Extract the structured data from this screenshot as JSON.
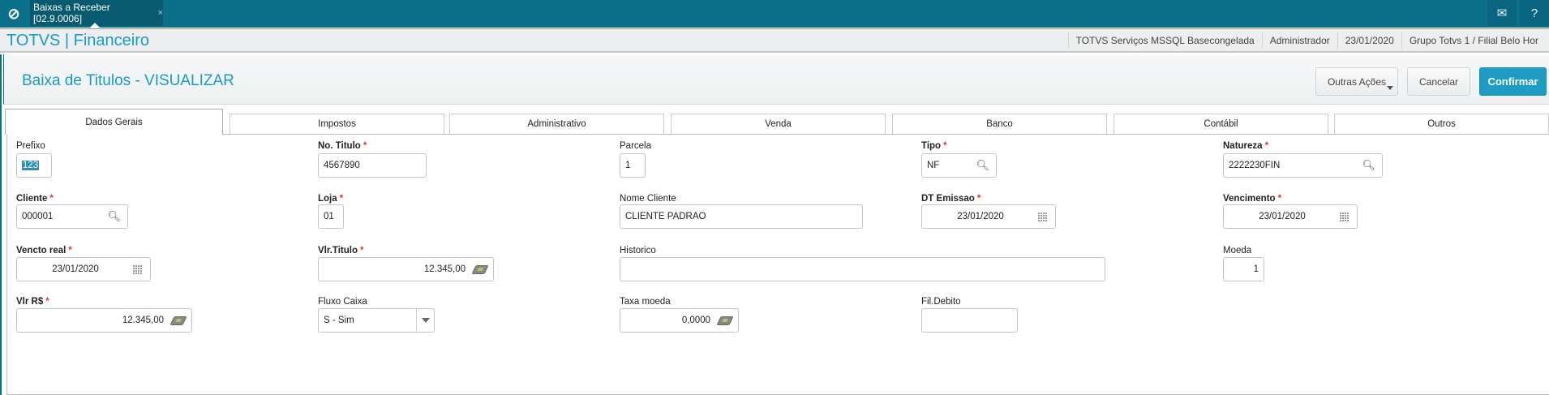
{
  "topbar": {
    "tab_label": "Baixas a Receber [02.9.0006]",
    "close_glyph": "×",
    "icons": [
      "totvs-logo-icon",
      "mail-icon",
      "help-icon"
    ]
  },
  "header": {
    "brand": "TOTVS | Financeiro",
    "environment": "TOTVS Serviços MSSQL Basecongelada",
    "user": "Administrador",
    "date": "23/01/2020",
    "branch": "Grupo Totvs 1 / Filial Belo Hor"
  },
  "page": {
    "title": "Baixa de Titulos - VISUALIZAR"
  },
  "actions": {
    "other": "Outras Ações",
    "cancel": "Cancelar",
    "confirm": "Confirmar"
  },
  "tabs": [
    "Dados Gerais",
    "Impostos",
    "Administrativo",
    "Venda",
    "Banco",
    "Contábil",
    "Outros"
  ],
  "active_tab": "Dados Gerais",
  "fields": {
    "prefixo": {
      "label": "Prefixo",
      "value": "123"
    },
    "no_titulo": {
      "label": "No. Titulo",
      "value": "4567890"
    },
    "parcela": {
      "label": "Parcela",
      "value": "1"
    },
    "tipo": {
      "label": "Tipo",
      "value": "NF"
    },
    "natureza": {
      "label": "Natureza",
      "value": "2222230FIN"
    },
    "cliente": {
      "label": "Cliente",
      "value": "000001"
    },
    "loja": {
      "label": "Loja",
      "value": "01"
    },
    "nome_cliente": {
      "label": "Nome Cliente",
      "value": "CLIENTE PADRAO"
    },
    "dt_emissao": {
      "label": "DT Emissao",
      "value": "23/01/2020"
    },
    "vencimento": {
      "label": "Vencimento",
      "value": "23/01/2020"
    },
    "vencto_real": {
      "label": "Vencto real",
      "value": "23/01/2020"
    },
    "vlr_titulo": {
      "label": "Vlr.Titulo",
      "value": "12.345,00"
    },
    "historico": {
      "label": "Historico",
      "value": ""
    },
    "moeda": {
      "label": "Moeda",
      "value": "1"
    },
    "vlr_rs": {
      "label": "Vlr R$",
      "value": "12.345,00"
    },
    "fluxo_caixa": {
      "label": "Fluxo Caixa",
      "value": "S - Sim"
    },
    "taxa_moeda": {
      "label": "Taxa moeda",
      "value": "0,0000"
    },
    "fil_debito": {
      "label": "Fil.Debito",
      "value": ""
    }
  },
  "required_marker": "*",
  "colors": {
    "topbar": "#0b718b",
    "accent": "#1a9bc4",
    "confirm": "#1e9cc4",
    "required": "#e53030"
  }
}
